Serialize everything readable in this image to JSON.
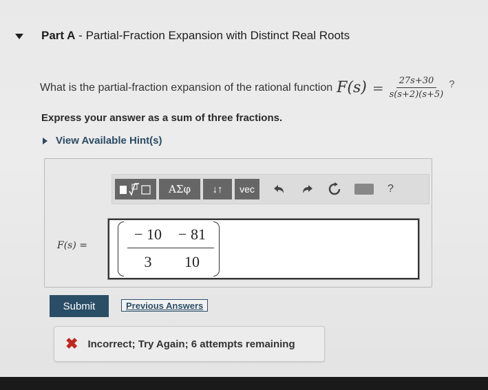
{
  "header": {
    "part_label": "Part A",
    "separator": " - ",
    "part_title": "Partial-Fraction Expansion with Distinct Real Roots"
  },
  "question": {
    "text": "What is the partial-fraction expansion of the rational function",
    "function_lhs": "F(s)",
    "equals": "=",
    "numerator": "27s+30",
    "denominator": "s(s+2)(s+5)",
    "end_mark": "?"
  },
  "instruction": "Express your answer as a sum of three fractions.",
  "hints_link": "View Available Hint(s)",
  "toolbar": {
    "greek_label": "ΑΣφ",
    "arrows_label": "↓↑",
    "vec_label": "vec",
    "help_label": "?"
  },
  "answer": {
    "label": "F(s) =",
    "num1": "− 10",
    "num2": "− 81",
    "den1": "3",
    "den2": "10"
  },
  "buttons": {
    "submit": "Submit",
    "previous_answers": "Previous Answers"
  },
  "feedback": {
    "icon": "x-icon",
    "text": "Incorrect; Try Again; 6 attempts remaining",
    "color": "#c1271f"
  }
}
